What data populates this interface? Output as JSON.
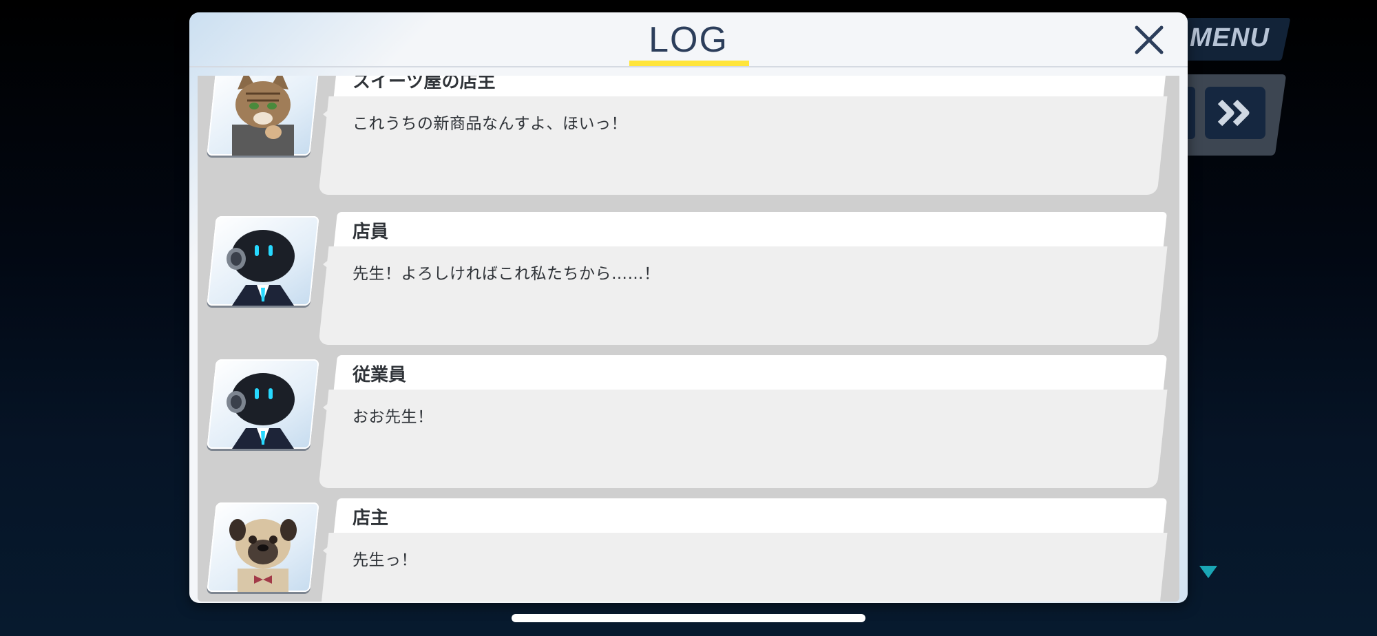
{
  "hud": {
    "menu_label": "MENU",
    "skip_icon": "double-chevron-right-icon",
    "next_icon": "triangle-down-icon"
  },
  "log_modal": {
    "title": "LOG",
    "close_icon": "close-icon",
    "entries": [
      {
        "speaker": "スイーツ屋の店主",
        "text": "これうちの新商品なんすよ、ほいっ！",
        "portrait": "cat-portrait"
      },
      {
        "speaker": "店員",
        "text": "先生！よろしければこれ私たちから……！",
        "portrait": "robot-portrait"
      },
      {
        "speaker": "従業員",
        "text": "おお先生！",
        "portrait": "robot-portrait"
      },
      {
        "speaker": "店主",
        "text": "先生っ！",
        "portrait": "pug-portrait"
      }
    ]
  },
  "colors": {
    "title": "#2c3e5b",
    "title_underline": "#ffe53b",
    "modal_bg": "#f4f6f9",
    "list_bg": "#cfcfcf",
    "robot_eyes": "#27d9ff"
  }
}
